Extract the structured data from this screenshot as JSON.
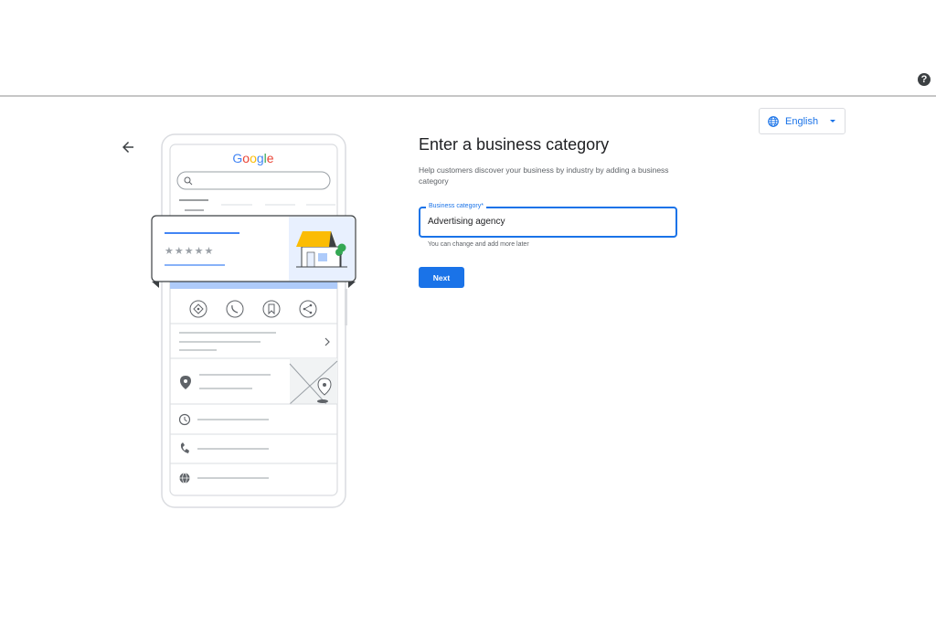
{
  "header": {
    "help_glyph": "?"
  },
  "language": {
    "label": "English"
  },
  "form": {
    "title": "Enter a business category",
    "subtitle": "Help customers discover your business by industry by adding a business category",
    "field_label": "Business category*",
    "field_value": "Advertising agency",
    "helper": "You can change and add more later",
    "next_label": "Next"
  },
  "illustration": {
    "logo": {
      "G": "G",
      "o1": "o",
      "o2": "o",
      "g": "g",
      "l": "l",
      "e": "e"
    },
    "rating_stars": "★★★★★"
  },
  "colors": {
    "accent": "#1a73e8",
    "logo_blue": "#4285f4",
    "logo_red": "#ea4335",
    "logo_yellow": "#fbbc04",
    "logo_green": "#34a853",
    "awning": "#fbbc04",
    "tree": "#34a853",
    "highlight": "#e8f0fe"
  },
  "icons": [
    "back-arrow-icon",
    "help-icon",
    "globe-icon",
    "caret-down-icon",
    "search-icon",
    "directions-icon",
    "phone-icon",
    "bookmark-icon",
    "share-icon",
    "chevron-right-icon",
    "location-pin-icon",
    "clock-icon",
    "globe-icon",
    "storefront-icon"
  ]
}
